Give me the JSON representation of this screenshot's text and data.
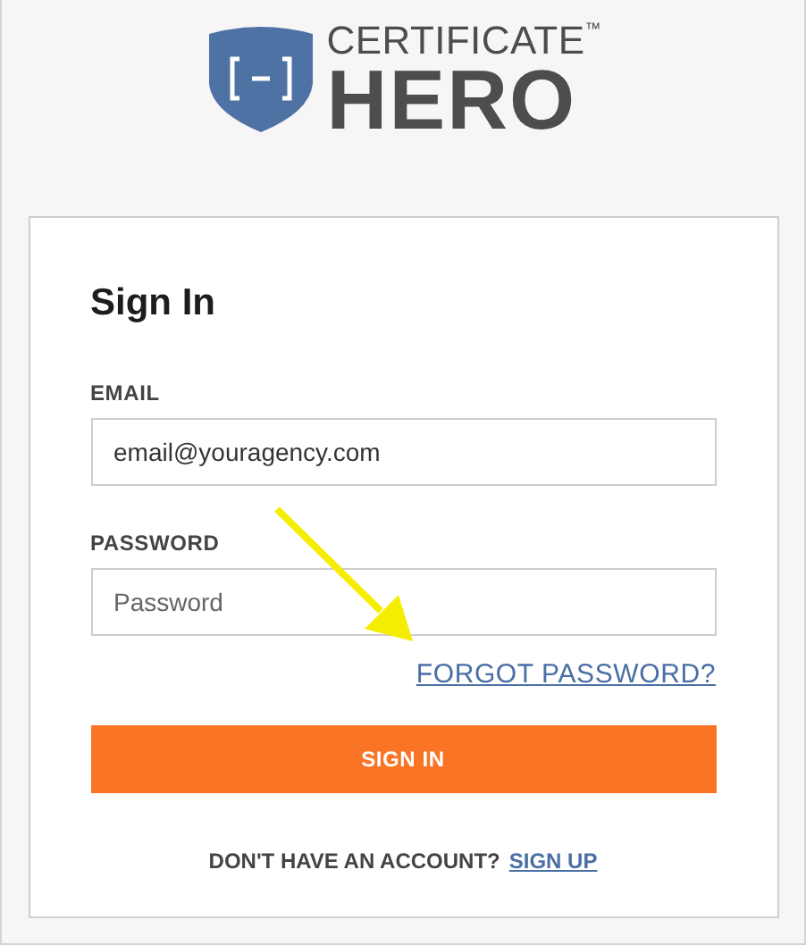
{
  "logo": {
    "top_word": "CERTIFICATE",
    "trademark": "™",
    "main_word": "HERO"
  },
  "form": {
    "title": "Sign In",
    "fields": [
      {
        "label": "EMAIL",
        "value": "email@youragency.com",
        "kind": "text"
      },
      {
        "label": "PASSWORD",
        "placeholder": "Password",
        "kind": "password"
      }
    ],
    "forgot_link": "FORGOT PASSWORD?",
    "submit": "SIGN IN",
    "signup_prompt": "DON'T HAVE AN ACCOUNT?",
    "signup_link": "SIGN UP"
  },
  "annotation": {
    "kind": "arrow"
  }
}
